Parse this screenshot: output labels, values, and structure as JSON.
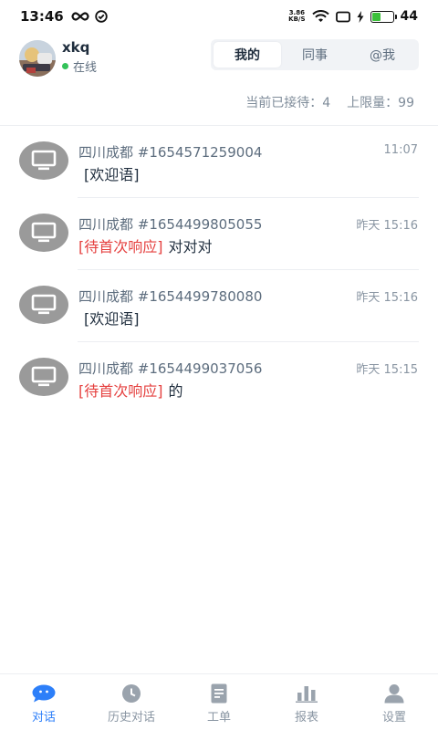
{
  "status_bar": {
    "time": "13:46",
    "net_speed_value": "3.86",
    "net_speed_unit": "KB/S",
    "battery_level": "44"
  },
  "header": {
    "user_name": "xkq",
    "user_status": "在线",
    "tabs": [
      {
        "label": "我的",
        "active": true
      },
      {
        "label": "同事",
        "active": false
      },
      {
        "label": "@我",
        "active": false
      }
    ]
  },
  "counts": {
    "current_label": "当前已接待：4",
    "limit_label": "上限量：99"
  },
  "conversations": [
    {
      "title": "四川成都 #1654571259004",
      "time": "11:07",
      "tag": "",
      "message": "[欢迎语]"
    },
    {
      "title": "四川成都 #1654499805055",
      "time": "昨天  15:16",
      "tag": "[待首次响应]",
      "message": "对对对"
    },
    {
      "title": "四川成都 #1654499780080",
      "time": "昨天  15:16",
      "tag": "",
      "message": "[欢迎语]"
    },
    {
      "title": "四川成都 #1654499037056",
      "time": "昨天  15:15",
      "tag": "[待首次响应]",
      "message": "的"
    }
  ],
  "bottom_nav": [
    {
      "label": "对话",
      "icon": "chat-bubble-icon",
      "active": true
    },
    {
      "label": "历史对话",
      "icon": "clock-icon",
      "active": false
    },
    {
      "label": "工单",
      "icon": "document-icon",
      "active": false
    },
    {
      "label": "报表",
      "icon": "bar-chart-icon",
      "active": false
    },
    {
      "label": "设置",
      "icon": "user-icon",
      "active": false
    }
  ],
  "colors": {
    "accent": "#2d7ff9",
    "pending_tag": "#e5403f",
    "online": "#33c259",
    "inactive_icon": "#9aa3ad"
  }
}
